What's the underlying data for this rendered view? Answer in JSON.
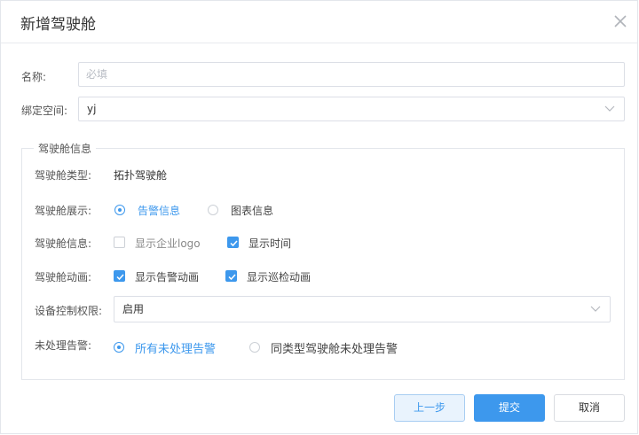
{
  "dialog": {
    "title": "新增驾驶舱"
  },
  "form": {
    "name": {
      "label": "名称:",
      "value": "",
      "placeholder": "必填"
    },
    "space": {
      "label": "绑定空间:",
      "value": "yj"
    }
  },
  "group": {
    "legend": "驾驶舱信息",
    "type": {
      "label": "驾驶舱类型:",
      "value": "拓扑驾驶舱"
    },
    "display": {
      "label": "驾驶舱展示:",
      "options": [
        {
          "label": "告警信息",
          "selected": true
        },
        {
          "label": "图表信息",
          "selected": false
        }
      ]
    },
    "info": {
      "label": "驾驶舱信息:",
      "options": [
        {
          "label": "显示企业logo",
          "checked": false
        },
        {
          "label": "显示时间",
          "checked": true
        }
      ]
    },
    "animation": {
      "label": "驾驶舱动画:",
      "options": [
        {
          "label": "显示告警动画",
          "checked": true
        },
        {
          "label": "显示巡检动画",
          "checked": true
        }
      ]
    },
    "permission": {
      "label": "设备控制权限:",
      "value": "启用"
    },
    "unhandled": {
      "label": "未处理告警:",
      "options": [
        {
          "label": "所有未处理告警",
          "selected": true
        },
        {
          "label": "同类型驾驶舱未处理告警",
          "selected": false
        }
      ]
    }
  },
  "buttons": {
    "prev": "上一步",
    "submit": "提交",
    "cancel": "取消"
  },
  "colors": {
    "accent": "#3d98ed",
    "border": "#dcdfe6"
  }
}
